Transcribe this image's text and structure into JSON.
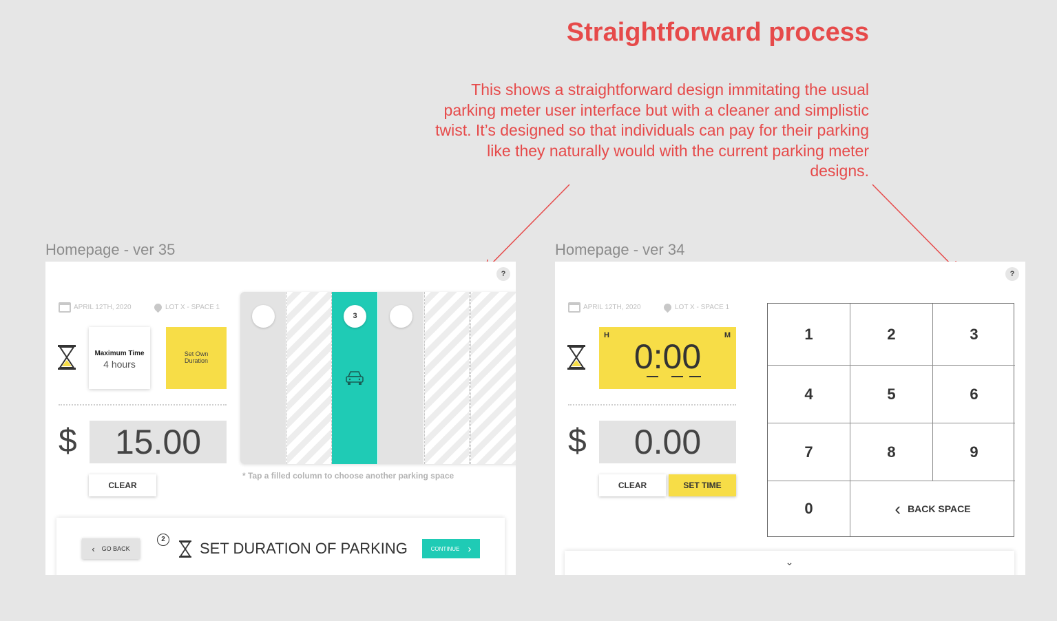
{
  "annotation": {
    "heading": "Straightforward process",
    "description": "This shows a straightforward design immitating the usual parking meter user interface but with a cleaner and simplistic twist. It’s designed so that individuals can pay for their parking like they naturally would with the current parking meter designs.",
    "accent_color": "#e64a4a"
  },
  "frame_a": {
    "label": "Homepage - ver 35",
    "help": "?",
    "date": "APRIL 12TH, 2020",
    "location": "LOT X - SPACE 1",
    "max_time_title": "Maximum Time",
    "max_time_value": "4 hours",
    "set_own_line1": "Set Own",
    "set_own_line2": "Duration",
    "currency": "$",
    "price": "15.00",
    "clear": "CLEAR",
    "selected_space": "3",
    "tap_note": "* Tap a filled column to choose another parking space",
    "go_back": "GO BACK",
    "step_number": "2",
    "step_title": "SET DURATION OF PARKING",
    "continue": "CONTINUE",
    "teal_color": "#1fcbb5",
    "yellow_color": "#f7dd47"
  },
  "frame_b": {
    "label": "Homepage - ver 34",
    "help": "?",
    "date": "APRIL 12TH, 2020",
    "location": "LOT X - SPACE 1",
    "hours_label": "H",
    "minutes_label": "M",
    "timer_value": "0:00",
    "currency": "$",
    "price": "0.00",
    "clear": "CLEAR",
    "set_time": "SET TIME",
    "keys": [
      "1",
      "2",
      "3",
      "4",
      "5",
      "6",
      "7",
      "8",
      "9",
      "0"
    ],
    "back_space": "BACK SPACE"
  }
}
